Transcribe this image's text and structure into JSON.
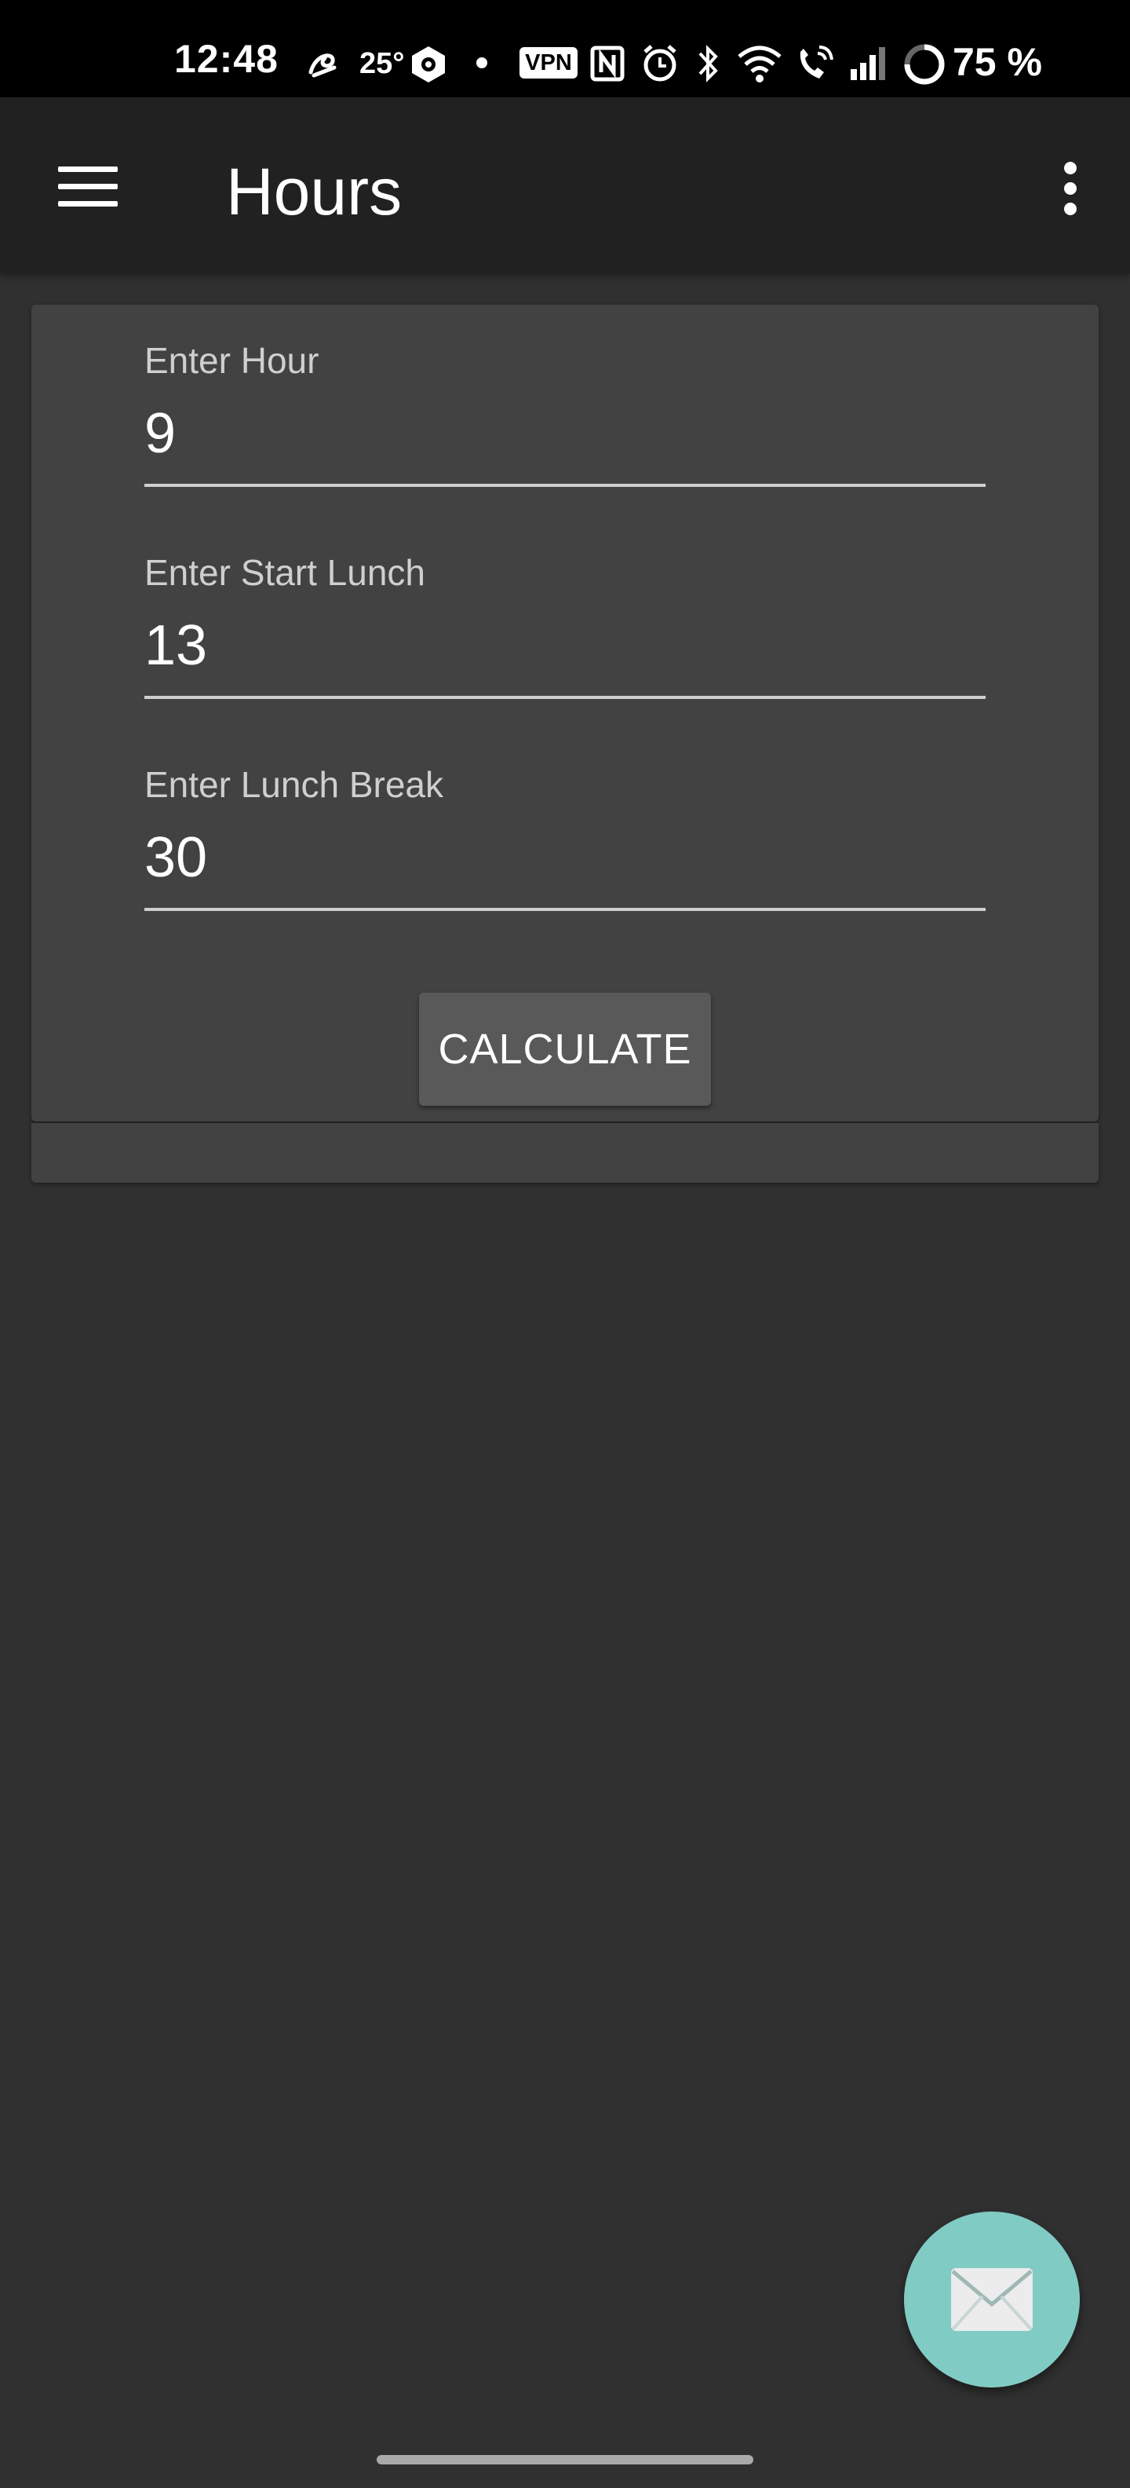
{
  "status_bar": {
    "time": "12:48",
    "temperature": "25°",
    "vpn_label": "VPN",
    "battery": "75 %",
    "icons": [
      "thread-icon",
      "weather-icon",
      "crypto-icon",
      "dot-icon",
      "vpn-icon",
      "nfc-icon",
      "alarm-icon",
      "bluetooth-icon",
      "wifi-icon",
      "wifi-call-icon",
      "signal-icon",
      "battery-ring-icon"
    ]
  },
  "app_bar": {
    "title": "Hours",
    "menu_icon": "hamburger-menu-icon",
    "overflow_icon": "more-vert-icon"
  },
  "form": {
    "hour": {
      "label": "Enter Hour",
      "value": "9"
    },
    "start_lunch": {
      "label": "Enter Start Lunch",
      "value": "13"
    },
    "lunch_break": {
      "label": "Enter Lunch Break",
      "value": "30"
    },
    "calculate_label": "CALCULATE"
  },
  "fab": {
    "icon": "email-icon"
  },
  "colors": {
    "background": "#303030",
    "app_bar": "#212121",
    "card": "#424242",
    "button": "#595959",
    "fab": "#80cbc4"
  }
}
